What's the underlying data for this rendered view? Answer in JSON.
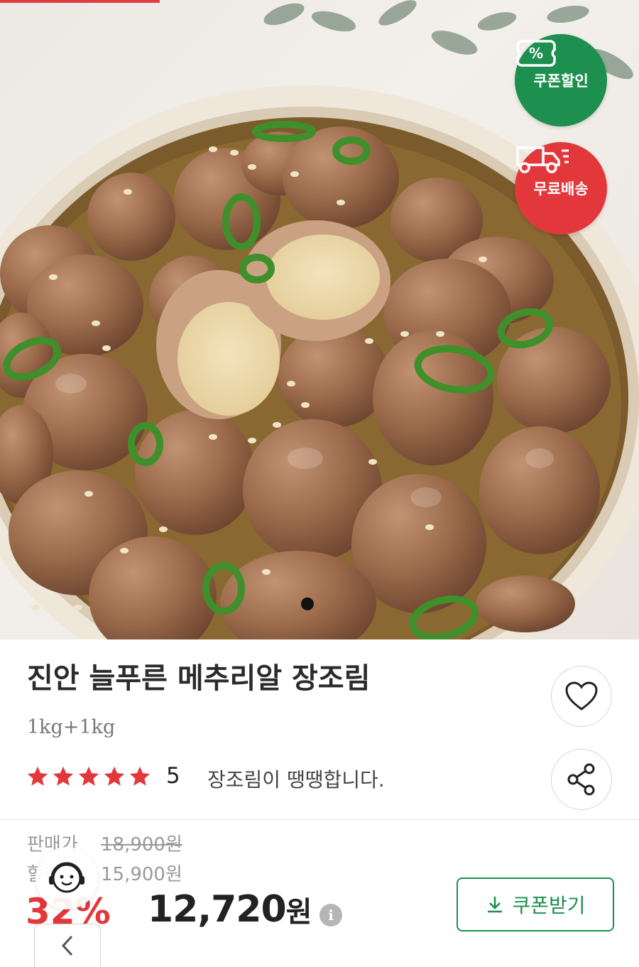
{
  "hero": {
    "badges": [
      {
        "label": "쿠폰할인",
        "icon": "coupon-percent-icon",
        "color": "#1d8f4f"
      },
      {
        "label": "무료배송",
        "icon": "delivery-truck-icon",
        "color": "#e3383b"
      }
    ],
    "carousel": {
      "current": 1
    }
  },
  "product": {
    "title": "진안 늘푸른 메추리알 장조림",
    "option": "1kg+1kg",
    "rating": {
      "stars": 5,
      "max": 5,
      "value": "5"
    },
    "review_snippet": "장조림이 땡땡합니다.",
    "wish_icon": "heart-icon",
    "share_icon": "share-icon"
  },
  "price": {
    "sale_label": "판매가",
    "original": "18,900원",
    "discount_label": "할인가",
    "discounted": "15,900원",
    "percent": "32%",
    "final_number": "12,720",
    "final_unit": "원",
    "info_icon": "i"
  },
  "coupon_button": {
    "label": "쿠폰받기",
    "icon": "download-icon"
  },
  "colors": {
    "accent_green": "#1d8f4f",
    "accent_red": "#e3383b"
  }
}
